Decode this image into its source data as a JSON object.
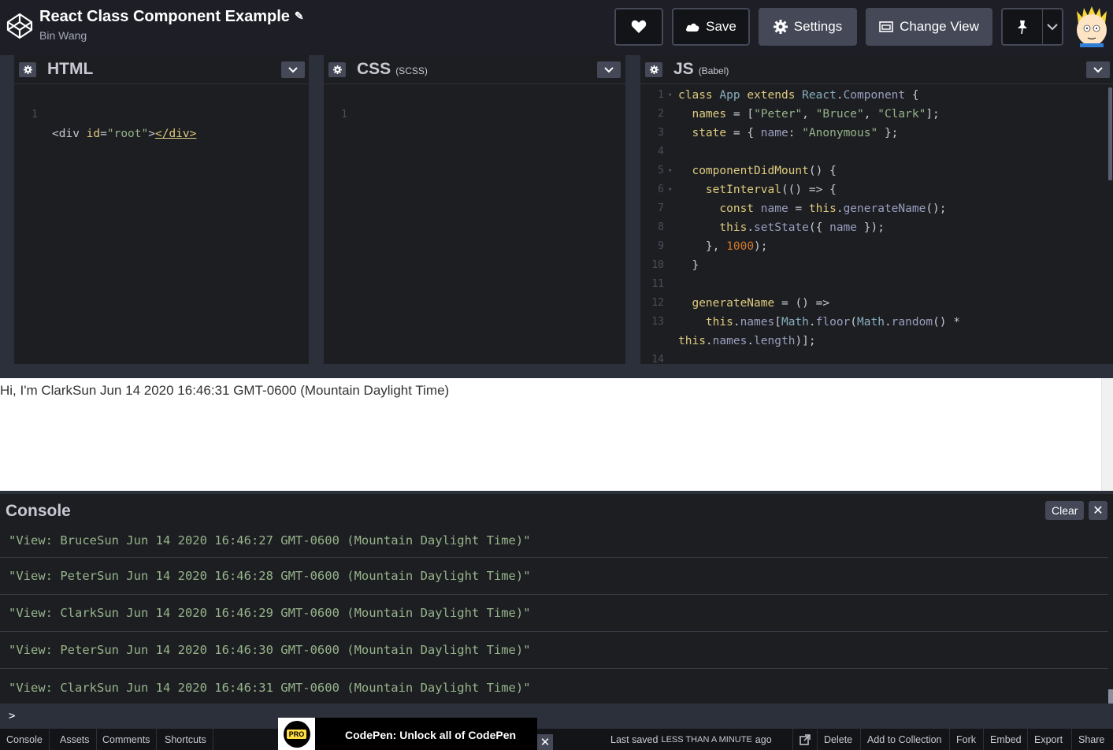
{
  "header": {
    "title": "React Class Component Example",
    "author": "Bin Wang",
    "save_label": "Save",
    "settings_label": "Settings",
    "change_view_label": "Change View"
  },
  "editors": {
    "html": {
      "title": "HTML",
      "subtitle": "",
      "lines": [
        {
          "n": "1",
          "fold": ""
        }
      ]
    },
    "css": {
      "title": "CSS",
      "subtitle": "(SCSS)",
      "lines": [
        {
          "n": "1"
        }
      ]
    },
    "js": {
      "title": "JS",
      "subtitle": "(Babel)",
      "line_numbers": [
        "1",
        "2",
        "3",
        "4",
        "5",
        "6",
        "7",
        "8",
        "9",
        "10",
        "11",
        "12",
        "13",
        "",
        "14"
      ]
    }
  },
  "code": {
    "html_line1": "<div id=\"root\"></div>",
    "js": [
      "class App extends React.Component {",
      "  names = [\"Peter\", \"Bruce\", \"Clark\"];",
      "  state = { name: \"Anonymous\" };",
      "",
      "  componentDidMount() {",
      "    setInterval(() => {",
      "      const name = this.generateName();",
      "      this.setState({ name });",
      "    }, 1000);",
      "  }",
      "",
      "  generateName = () =>",
      "    this.names[Math.floor(Math.random() *",
      "this.names.length)];"
    ]
  },
  "preview": {
    "text": "Hi, I'm ClarkSun Jun 14 2020 16:46:31 GMT-0600 (Mountain Daylight Time)"
  },
  "console": {
    "title": "Console",
    "clear_label": "Clear",
    "logs": [
      "\"View: BruceSun Jun 14 2020 16:46:27 GMT-0600 (Mountain Daylight Time)\"",
      "\"View: PeterSun Jun 14 2020 16:46:28 GMT-0600 (Mountain Daylight Time)\"",
      "\"View: ClarkSun Jun 14 2020 16:46:29 GMT-0600 (Mountain Daylight Time)\"",
      "\"View: PeterSun Jun 14 2020 16:46:30 GMT-0600 (Mountain Daylight Time)\"",
      "\"View: ClarkSun Jun 14 2020 16:46:31 GMT-0600 (Mountain Daylight Time)\""
    ],
    "prompt": ">"
  },
  "footer": {
    "tabs": [
      "Console",
      "Assets",
      "Comments",
      "Shortcuts"
    ],
    "promo_badge": "PRO",
    "promo_text": "CodePen: Unlock all of CodePen",
    "saved_prefix": "Last saved",
    "saved_caps": "LESS THAN A MINUTE",
    "saved_suffix": "ago",
    "actions": [
      "Delete",
      "Add to Collection",
      "Fork",
      "Embed",
      "Export",
      "Share"
    ]
  }
}
